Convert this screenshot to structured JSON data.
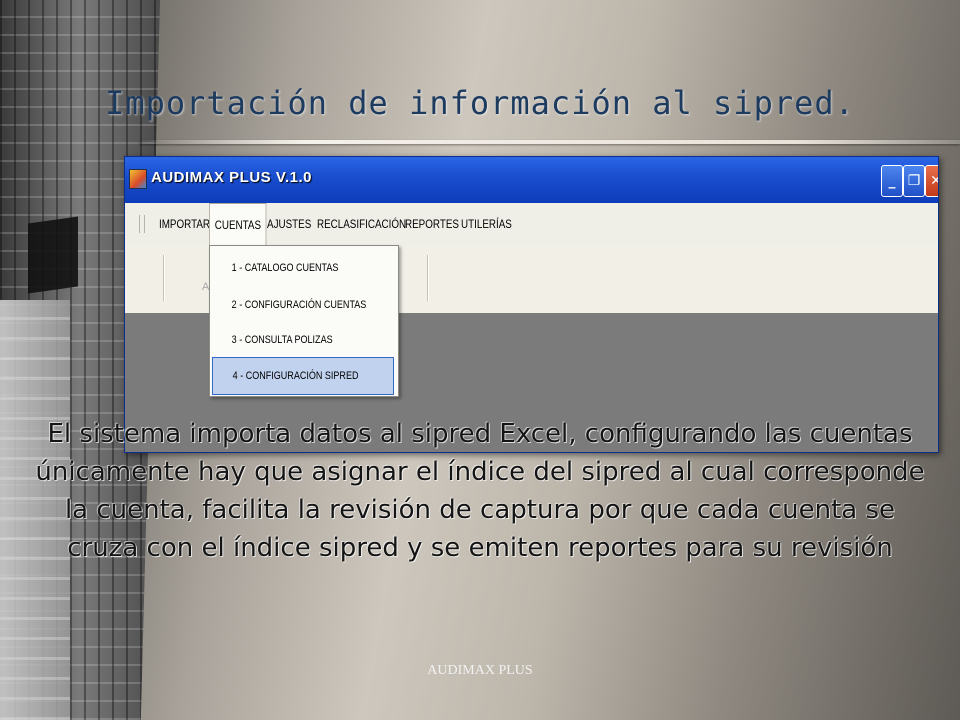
{
  "slide": {
    "title": "Importación de información al sipred.",
    "body": "El sistema importa datos al sipred Excel, configurando las cuentas únicamente hay que asignar el índice del sipred al cual corresponde la cuenta, facilita la revisión de captura por que cada cuenta se cruza con el índice sipred y se emiten reportes para su revisión",
    "footer": "AUDIMAX PLUS"
  },
  "window": {
    "title": "AUDIMAX PLUS V.1.0",
    "controls": {
      "minimize": "_",
      "restore": "❐",
      "close": "✕"
    }
  },
  "menu": {
    "items": [
      "IMPORTAR",
      "CUENTAS",
      "AJUSTES",
      "RECLASIFICACIÓN",
      "REPORTES",
      "UTILERÍAS"
    ],
    "active": "CUENTAS"
  },
  "toolbar": {
    "faint_label": "A"
  },
  "dropdown": {
    "items": [
      "1 - CATALOGO CUENTAS",
      "2 - CONFIGURACIÓN CUENTAS",
      "3 - CONSULTA POLIZAS",
      "4 - CONFIGURACIÓN SIPRED"
    ],
    "selected": "4 - CONFIGURACIÓN SIPRED"
  },
  "colors": {
    "titlebar": "#1a4fd0",
    "title_text": "#1d3a5f",
    "selection": "#c1d2ee"
  }
}
